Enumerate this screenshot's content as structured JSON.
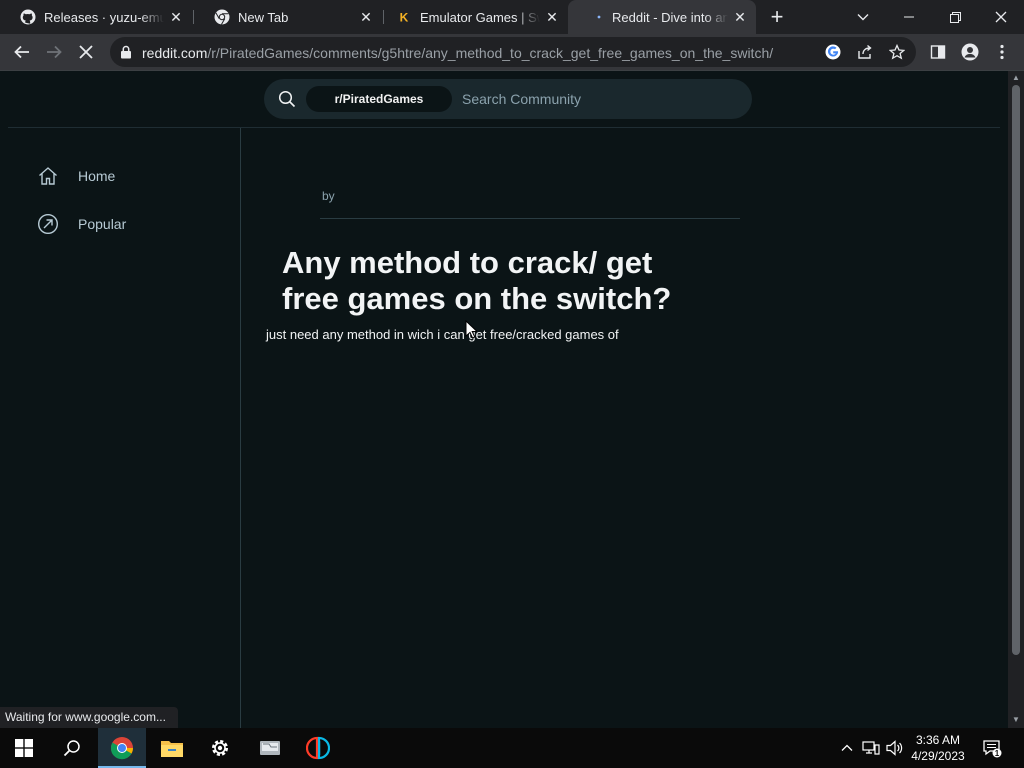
{
  "browser": {
    "tabs": [
      {
        "title": "Releases · yuzu-emu/yuzu-mainline",
        "favicon": "github-icon",
        "active": false
      },
      {
        "title": "New Tab",
        "favicon": "chrome-icon",
        "active": false
      },
      {
        "title": "Emulator Games | Switch ROMs",
        "favicon": "k-logo-icon",
        "active": false
      },
      {
        "title": "Reddit - Dive into anything",
        "favicon": "loading-dot-icon",
        "active": true
      }
    ],
    "url_host": "reddit.com",
    "url_path": "/r/PiratedGames/comments/g5htre/any_method_to_crack_get_free_games_on_the_switch/",
    "status_text": "Waiting for www.google.com..."
  },
  "reddit": {
    "community": "r/PiratedGames",
    "search_placeholder": "Search Community",
    "nav": [
      {
        "label": "Home",
        "icon": "home-icon"
      },
      {
        "label": "Popular",
        "icon": "popular-arrow-icon"
      }
    ],
    "post": {
      "by_label": "by",
      "title": "Any method to crack/ get free games on the switch?",
      "body": "just need any method in wich i can get free/cracked games of"
    }
  },
  "taskbar": {
    "time": "3:36 AM",
    "date": "4/29/2023",
    "notification_count": "1"
  },
  "colors": {
    "page_bg": "#0b1416",
    "chrome_dark": "#202124",
    "chrome_toolbar": "#35363a",
    "search_bg": "#1a282d",
    "text_primary": "#f2f4f5",
    "text_muted": "#8ba2ad"
  }
}
